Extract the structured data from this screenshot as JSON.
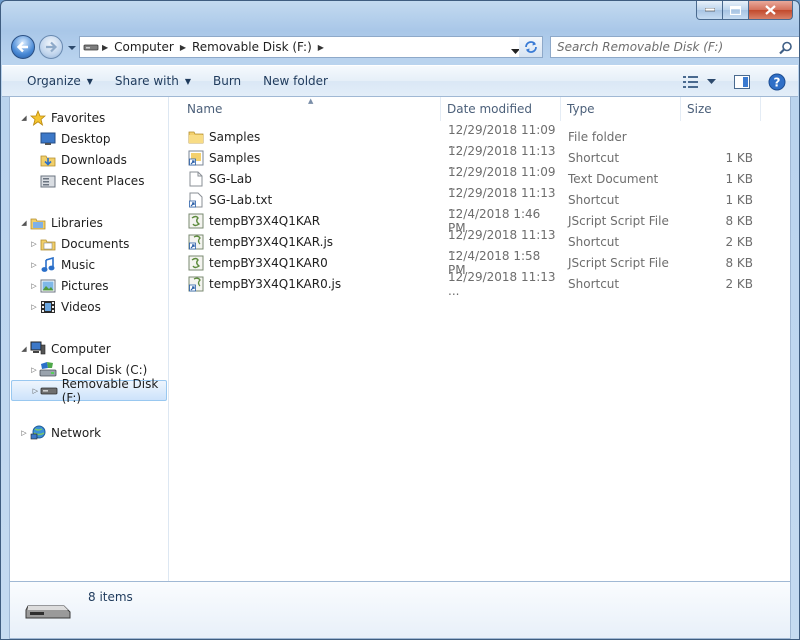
{
  "address": {
    "crumbs": [
      "Computer",
      "Removable Disk (F:)"
    ]
  },
  "search": {
    "placeholder": "Search Removable Disk (F:)"
  },
  "toolbar": {
    "organize": "Organize",
    "share_with": "Share with",
    "burn": "Burn",
    "new_folder": "New folder"
  },
  "nav": {
    "favorites": "Favorites",
    "desktop": "Desktop",
    "downloads": "Downloads",
    "recent_places": "Recent Places",
    "libraries": "Libraries",
    "documents": "Documents",
    "music": "Music",
    "pictures": "Pictures",
    "videos": "Videos",
    "computer": "Computer",
    "local_disk": "Local Disk (C:)",
    "removable_disk": "Removable Disk (F:)",
    "network": "Network"
  },
  "columns": {
    "name": "Name",
    "date": "Date modified",
    "type": "Type",
    "size": "Size"
  },
  "files": [
    {
      "name": "Samples",
      "date": "12/29/2018 11:09 ...",
      "type": "File folder",
      "size": "",
      "icon": "folder-icon"
    },
    {
      "name": "Samples",
      "date": "12/29/2018 11:13 ...",
      "type": "Shortcut",
      "size": "1 KB",
      "icon": "shortcut-icon"
    },
    {
      "name": "SG-Lab",
      "date": "12/29/2018 11:09 ...",
      "type": "Text Document",
      "size": "1 KB",
      "icon": "text-document-icon"
    },
    {
      "name": "SG-Lab.txt",
      "date": "12/29/2018 11:13 ...",
      "type": "Shortcut",
      "size": "1 KB",
      "icon": "shortcut-icon"
    },
    {
      "name": "tempBY3X4Q1KAR",
      "date": "12/4/2018 1:46 PM",
      "type": "JScript Script File",
      "size": "8 KB",
      "icon": "script-file-icon"
    },
    {
      "name": "tempBY3X4Q1KAR.js",
      "date": "12/29/2018 11:13 ...",
      "type": "Shortcut",
      "size": "2 KB",
      "icon": "shortcut-icon"
    },
    {
      "name": "tempBY3X4Q1KAR0",
      "date": "12/4/2018 1:58 PM",
      "type": "JScript Script File",
      "size": "8 KB",
      "icon": "script-file-icon"
    },
    {
      "name": "tempBY3X4Q1KAR0.js",
      "date": "12/29/2018 11:13 ...",
      "type": "Shortcut",
      "size": "2 KB",
      "icon": "shortcut-icon"
    }
  ],
  "status": {
    "item_count": "8 items"
  }
}
